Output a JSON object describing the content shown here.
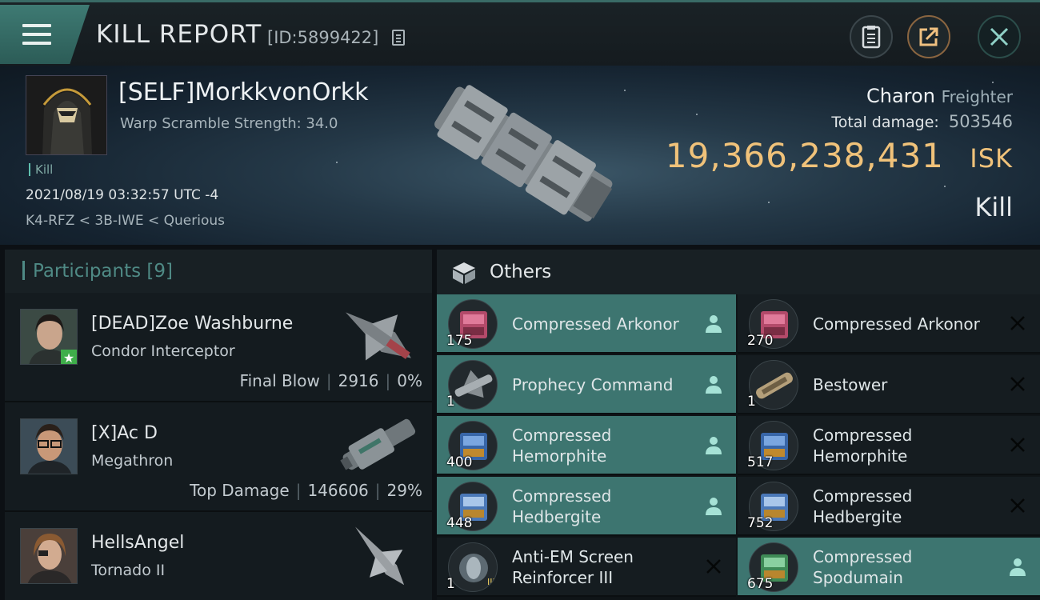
{
  "header": {
    "title": "KILL REPORT",
    "report_id": "[ID:5899422]"
  },
  "victim": {
    "name": "[SELF]MorkkvonOrkk",
    "warp_scramble": "Warp Scramble Strength: 34.0",
    "kill_tag": "Kill",
    "datetime": "2021/08/19 03:32:57 UTC -4",
    "location": "K4-RFZ < 3B-IWE < Querious",
    "ship_name": "Charon",
    "ship_class": "Freighter",
    "total_damage_label": "Total damage:",
    "total_damage": "503546",
    "isk_value": "19,366,238,431",
    "isk_unit": "ISK",
    "result": "Kill"
  },
  "participants": {
    "label": "Participants",
    "count": "[9]",
    "rows": [
      {
        "name": "[DEAD]Zoe Washburne",
        "ship": "Condor Interceptor",
        "role": "Final Blow",
        "damage": "2916",
        "percent": "0%"
      },
      {
        "name": "[X]Ac D",
        "ship": "Megathron",
        "role": "Top Damage",
        "damage": "146606",
        "percent": "29%"
      },
      {
        "name": "HellsAngel",
        "ship": "Tornado II",
        "role": "",
        "damage": "",
        "percent": ""
      }
    ]
  },
  "others": {
    "label": "Others",
    "items": [
      {
        "name": "Compressed Arkonor",
        "qty": "175",
        "dropped": true,
        "col": 0
      },
      {
        "name": "Compressed Arkonor",
        "qty": "270",
        "dropped": false,
        "col": 1
      },
      {
        "name": "Prophecy Command",
        "qty": "1",
        "dropped": true,
        "col": 0
      },
      {
        "name": "Bestower",
        "qty": "1",
        "dropped": false,
        "col": 1
      },
      {
        "name": "Compressed Hemorphite",
        "line1": "Compressed",
        "line2": "Hemorphite",
        "qty": "400",
        "dropped": true,
        "col": 0
      },
      {
        "name": "Compressed Hemorphite",
        "line1": "Compressed",
        "line2": "Hemorphite",
        "qty": "517",
        "dropped": false,
        "col": 1
      },
      {
        "name": "Compressed Hedbergite",
        "line1": "Compressed",
        "line2": "Hedbergite",
        "qty": "448",
        "dropped": true,
        "col": 0
      },
      {
        "name": "Compressed Hedbergite",
        "line1": "Compressed",
        "line2": "Hedbergite",
        "qty": "752",
        "dropped": false,
        "col": 1
      },
      {
        "name": "Anti-EM Screen Reinforcer III",
        "line1": "Anti-EM Screen",
        "line2": "Reinforcer III",
        "qty": "1",
        "dropped": false,
        "col": 0
      },
      {
        "name": "Compressed Spodumain",
        "line1": "Compressed",
        "line2": "Spodumain",
        "qty": "675",
        "dropped": true,
        "col": 1
      }
    ]
  },
  "colors": {
    "accent_teal": "#3d7570",
    "isk_gold": "#f0c27a",
    "header_teal": "#4f8a85"
  },
  "icons": [
    "menu-icon",
    "copy-icon",
    "clipboard-icon",
    "share-icon",
    "close-icon",
    "cube-icon",
    "person-icon",
    "x-icon"
  ]
}
